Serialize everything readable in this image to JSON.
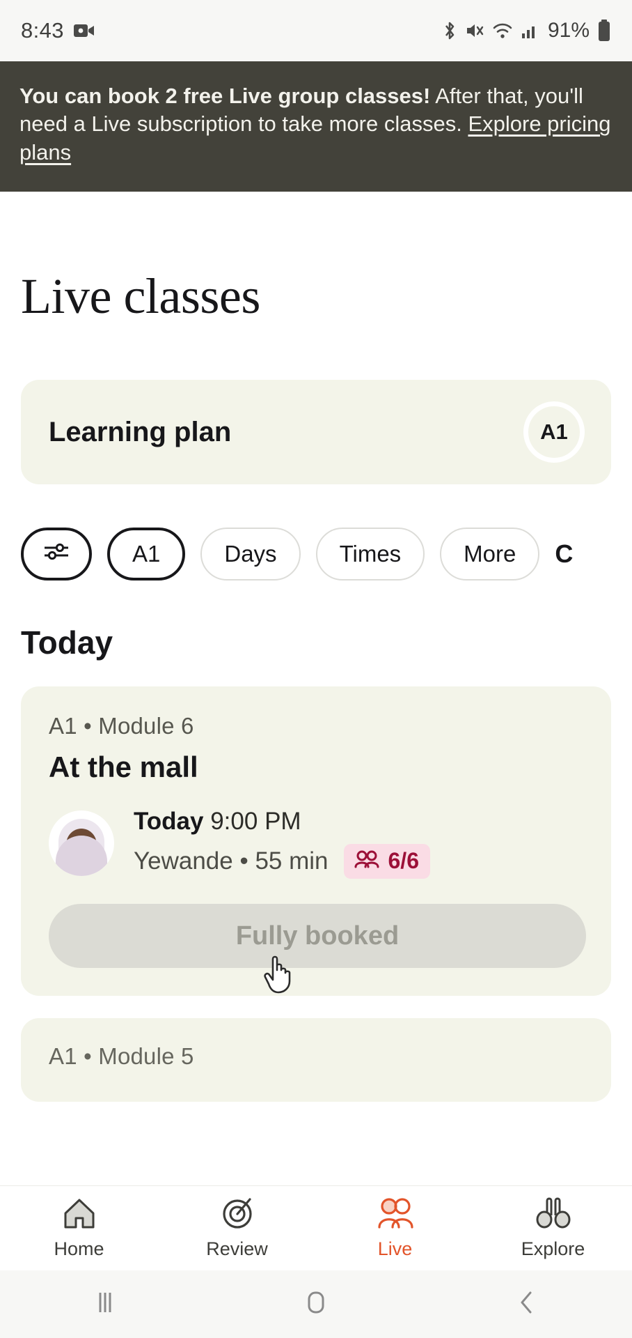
{
  "status_bar": {
    "time": "8:43",
    "battery_percent": "91%",
    "icons": [
      "video-recording-icon",
      "bluetooth-icon",
      "mute-icon",
      "wifi-icon",
      "signal-icon",
      "battery-icon"
    ]
  },
  "promo_banner": {
    "bold_text": "You can book 2 free Live group classes!",
    "rest_text": " After that, you'll need a Live subscription to take more classes. ",
    "link_text": "Explore pricing plans",
    "background": "#43423a",
    "text_color": "#f3f2ec"
  },
  "page": {
    "title": "Live classes"
  },
  "learning_plan": {
    "title": "Learning plan",
    "level_badge": "A1",
    "card_background": "#f3f4e9"
  },
  "filters": {
    "chips": [
      {
        "label": "",
        "icon": "sliders-icon",
        "active": true
      },
      {
        "label": "A1",
        "icon": "",
        "active": true
      },
      {
        "label": "Days",
        "icon": "",
        "active": false
      },
      {
        "label": "Times",
        "icon": "",
        "active": false
      },
      {
        "label": "More",
        "icon": "",
        "active": false
      },
      {
        "label": "C",
        "icon": "",
        "active": false
      }
    ]
  },
  "sections": [
    {
      "title": "Today",
      "classes": [
        {
          "meta": "A1 • Module 6",
          "title": "At the mall",
          "day": "Today",
          "time": "9:00 PM",
          "tutor": "Yewande",
          "duration": "55 min",
          "capacity": "6/6",
          "capacity_icon": "people-icon",
          "capacity_bg": "#fadce5",
          "capacity_color": "#9c1038",
          "button_label": "Fully booked",
          "button_disabled": true
        },
        {
          "meta": "A1 • Module 5",
          "title": "",
          "day": "",
          "time": "",
          "tutor": "",
          "duration": "",
          "capacity": "",
          "button_label": ""
        }
      ]
    }
  ],
  "bottom_nav": {
    "active_color": "#e2542a",
    "items": [
      {
        "label": "Home",
        "icon": "home-icon",
        "active": false
      },
      {
        "label": "Review",
        "icon": "target-icon",
        "active": false
      },
      {
        "label": "Live",
        "icon": "people-icon",
        "active": true
      },
      {
        "label": "Explore",
        "icon": "binoculars-icon",
        "active": false
      }
    ]
  },
  "system_nav": {
    "items": [
      {
        "name": "recents",
        "icon": "recents-icon"
      },
      {
        "name": "home",
        "icon": "home-square-icon"
      },
      {
        "name": "back",
        "icon": "back-chevron-icon"
      }
    ]
  },
  "cursor": {
    "type": "pointing-hand"
  }
}
